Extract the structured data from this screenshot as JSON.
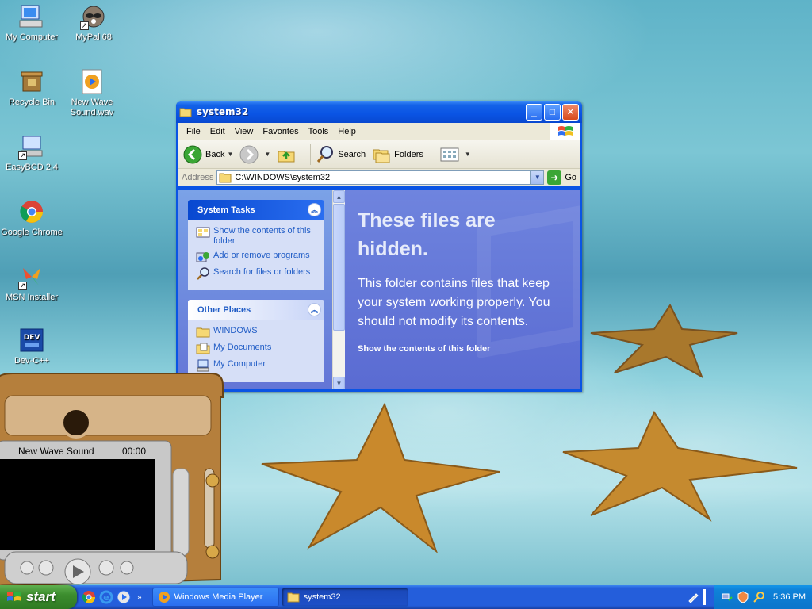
{
  "desktop": {
    "icons": [
      {
        "label": "My Computer"
      },
      {
        "label": "MyPal 68"
      },
      {
        "label": "Recycle Bin"
      },
      {
        "label": "New Wave Sound.wav"
      },
      {
        "label": "EasyBCD 2.4"
      },
      {
        "label": "Google Chrome"
      },
      {
        "label": "MSN Installer"
      },
      {
        "label": "Dev-C++"
      }
    ]
  },
  "window": {
    "title": "system32",
    "menu": [
      "File",
      "Edit",
      "View",
      "Favorites",
      "Tools",
      "Help"
    ],
    "toolbar": {
      "back": "Back",
      "search": "Search",
      "folders": "Folders"
    },
    "address": {
      "label": "Address",
      "value": "C:\\WINDOWS\\system32",
      "go": "Go"
    },
    "system_tasks": {
      "title": "System Tasks",
      "items": [
        "Show the contents of this folder",
        "Add or remove programs",
        "Search for files or folders"
      ]
    },
    "other_places": {
      "title": "Other Places",
      "items": [
        "WINDOWS",
        "My Documents",
        "My Computer"
      ]
    },
    "hidden_notice": {
      "title": "These files are hidden.",
      "body": "This folder contains files that keep your system working properly. You should not modify its contents.",
      "link": "Show the contents of this folder"
    }
  },
  "media_player": {
    "track": "New Wave Sound",
    "time": "00:00"
  },
  "taskbar": {
    "start": "start",
    "tasks": [
      {
        "label": "Windows Media Player",
        "active": false
      },
      {
        "label": "system32",
        "active": true
      }
    ],
    "clock": "5:36 PM"
  },
  "colors": {
    "xp_blue": "#0a54e4",
    "task_pane": "#6375d6",
    "start_green": "#3c8d2e"
  }
}
